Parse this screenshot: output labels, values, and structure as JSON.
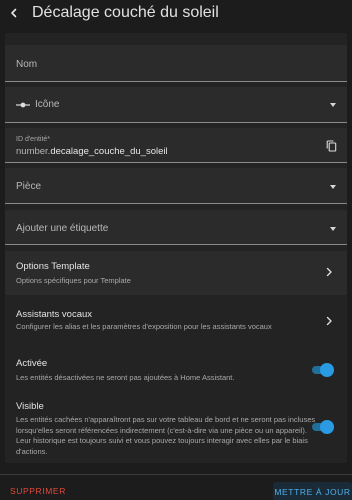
{
  "header": {
    "title": "Décalage couché du soleil"
  },
  "fields": {
    "name": {
      "placeholder": "Nom"
    },
    "icon": {
      "placeholder": "Icône"
    },
    "entity_id": {
      "label": "ID d'entité*",
      "prefix": "number.",
      "value": "decalage_couche_du_soleil"
    },
    "area": {
      "placeholder": "Pièce"
    },
    "labels": {
      "placeholder": "Ajouter une étiquette"
    }
  },
  "template_options": {
    "title": "Options Template",
    "description": "Options spécifiques pour Template"
  },
  "voice_assistants": {
    "title": "Assistants vocaux",
    "description": "Configurer les alias et les paramètres d'exposition pour les assistants vocaux"
  },
  "enabled": {
    "title": "Activée",
    "description": "Les entités désactivées ne seront pas ajoutées à Home Assistant.",
    "on": true
  },
  "visible": {
    "title": "Visible",
    "description": "Les entités cachées n'apparaîtront pas sur votre tableau de bord et ne seront pas incluses lorsqu'elles seront référencées indirectement (c'est-à-dire via une pièce ou un appareil). Leur historique est toujours suivi et vous pouvez toujours interagir avec elles par le biais d'actions.",
    "on": true
  },
  "footer": {
    "delete_label": "SUPPRIMER",
    "update_label": "METTRE À JOUR"
  },
  "colors": {
    "accent": "#2a9be2",
    "danger": "#e04a3a",
    "background": "#1c1c1c"
  }
}
